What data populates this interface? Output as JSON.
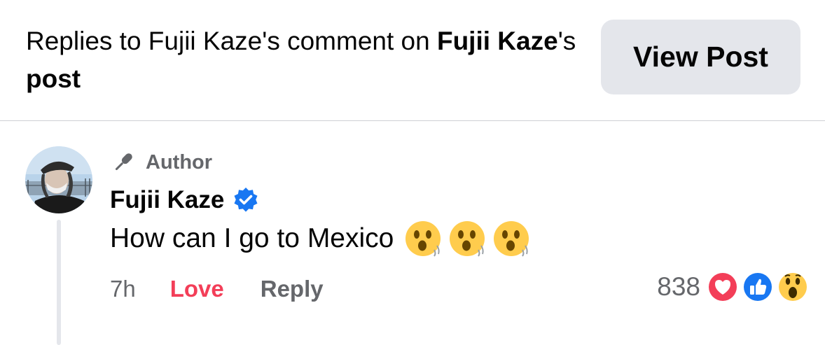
{
  "header": {
    "title_parts": {
      "prefix": "Replies to Fujii Kaze's comment on ",
      "bold_name": "Fujii Kaze",
      "mid": "'s ",
      "bold_post": "post"
    },
    "view_post_label": "View Post"
  },
  "comment": {
    "badge_label": "Author",
    "badge_icon": "microphone-icon",
    "author_name": "Fujii Kaze",
    "verified_icon": "verified-badge-icon",
    "text": "How can I go to Mexico",
    "emojis": [
      "hushed-face-emoji",
      "hushed-face-emoji",
      "hushed-face-emoji"
    ],
    "time": "7h",
    "love_label": "Love",
    "reply_label": "Reply",
    "reaction_count": "838",
    "reaction_icons": [
      "love-reaction-icon",
      "like-reaction-icon",
      "wow-reaction-icon"
    ]
  },
  "colors": {
    "love_active": "#f33e58",
    "secondary_text": "#65676b",
    "verified_blue": "#1877f2",
    "button_bg": "#e4e6eb"
  }
}
